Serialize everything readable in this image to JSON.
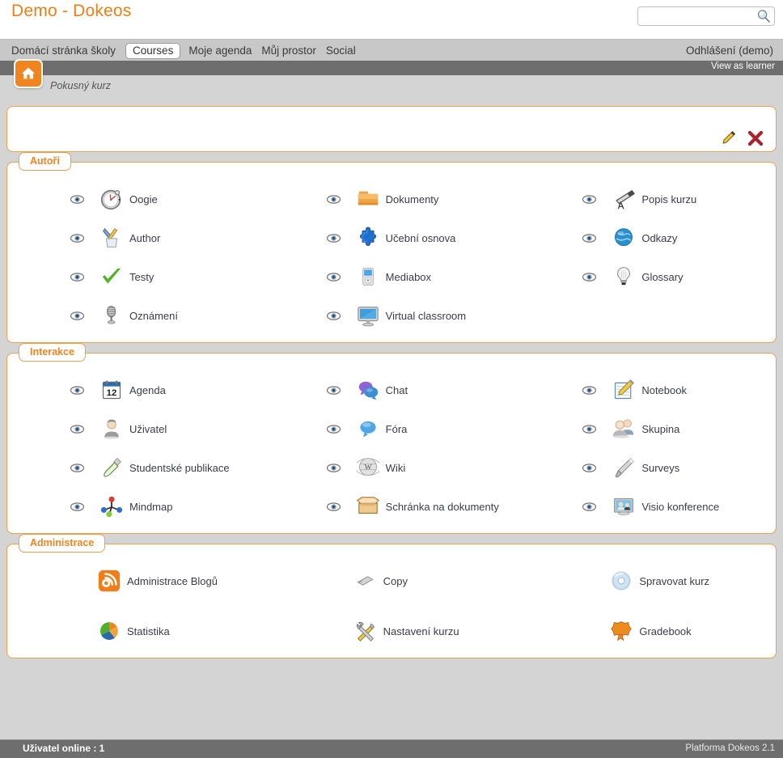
{
  "header": {
    "brand": "Demo - Dokeos",
    "search_value": "",
    "search_placeholder": ""
  },
  "nav": {
    "items": [
      {
        "label": "Domácí stránka školy",
        "active": false
      },
      {
        "label": "Courses",
        "active": true
      },
      {
        "label": "Moje agenda",
        "active": false
      },
      {
        "label": "Můj prostor",
        "active": false
      },
      {
        "label": "Social",
        "active": false
      }
    ],
    "logout": "Odhlášení (demo)",
    "view_as_learner": "View as learner"
  },
  "breadcrumb": {
    "home_icon": "home-icon",
    "course": "Pokusný kurz"
  },
  "intro": {
    "content": "",
    "edit_icon": "pencil-icon",
    "delete_icon": "close-x-icon"
  },
  "sections": [
    {
      "title": "Autoři",
      "show_eye": true,
      "tools": [
        {
          "label": "Oogie",
          "icon": "stopwatch-icon"
        },
        {
          "label": "Dokumenty",
          "icon": "folder-icon"
        },
        {
          "label": "Popis kurzu",
          "icon": "telescope-icon"
        },
        {
          "label": "Author",
          "icon": "pen-cup-icon"
        },
        {
          "label": "Učební osnova",
          "icon": "puzzle-icon"
        },
        {
          "label": "Odkazy",
          "icon": "globe-icon"
        },
        {
          "label": "Testy",
          "icon": "green-check-icon"
        },
        {
          "label": "Mediabox",
          "icon": "media-player-icon"
        },
        {
          "label": "Glossary",
          "icon": "lightbulb-icon"
        },
        {
          "label": "Oznámení",
          "icon": "microphone-icon"
        },
        {
          "label": "Virtual classroom",
          "icon": "monitor-icon"
        }
      ]
    },
    {
      "title": "Interakce",
      "show_eye": true,
      "tools": [
        {
          "label": "Agenda",
          "icon": "calendar-icon"
        },
        {
          "label": "Chat",
          "icon": "chat-bubbles-icon"
        },
        {
          "label": "Notebook",
          "icon": "notepad-pencil-icon"
        },
        {
          "label": "Uživatel",
          "icon": "user-icon"
        },
        {
          "label": "Fóra",
          "icon": "speech-bubble-icon"
        },
        {
          "label": "Skupina",
          "icon": "group-icon"
        },
        {
          "label": "Studentské publikace",
          "icon": "trowel-icon"
        },
        {
          "label": "Wiki",
          "icon": "wiki-globe-icon"
        },
        {
          "label": "Surveys",
          "icon": "flashlight-icon"
        },
        {
          "label": "Mindmap",
          "icon": "mindmap-icon"
        },
        {
          "label": "Schránka na dokumenty",
          "icon": "open-box-icon"
        },
        {
          "label": "Visio konference",
          "icon": "videoconference-icon"
        }
      ]
    },
    {
      "title": "Administrace",
      "show_eye": false,
      "tools": [
        {
          "label": "Administrace Blogů",
          "icon": "blog-icon"
        },
        {
          "label": "Copy",
          "icon": "usb-stick-icon"
        },
        {
          "label": "Spravovat kurz",
          "icon": "cd-disc-icon"
        },
        {
          "label": "Statistika",
          "icon": "pie-chart-icon"
        },
        {
          "label": "Nastavení kurzu",
          "icon": "tools-icon"
        },
        {
          "label": "Gradebook",
          "icon": "badge-icon"
        }
      ]
    }
  ],
  "footer": {
    "users_online": "Uživatel online : 1",
    "platform": "Platforma Dokeos 2.1"
  },
  "colors": {
    "brand_orange": "#f07d16",
    "panel_border": "#f0a04a",
    "nav_bg": "#c8c8c8",
    "dark_bar": "#6e6e6e",
    "body_bg": "#d4d4d4"
  }
}
